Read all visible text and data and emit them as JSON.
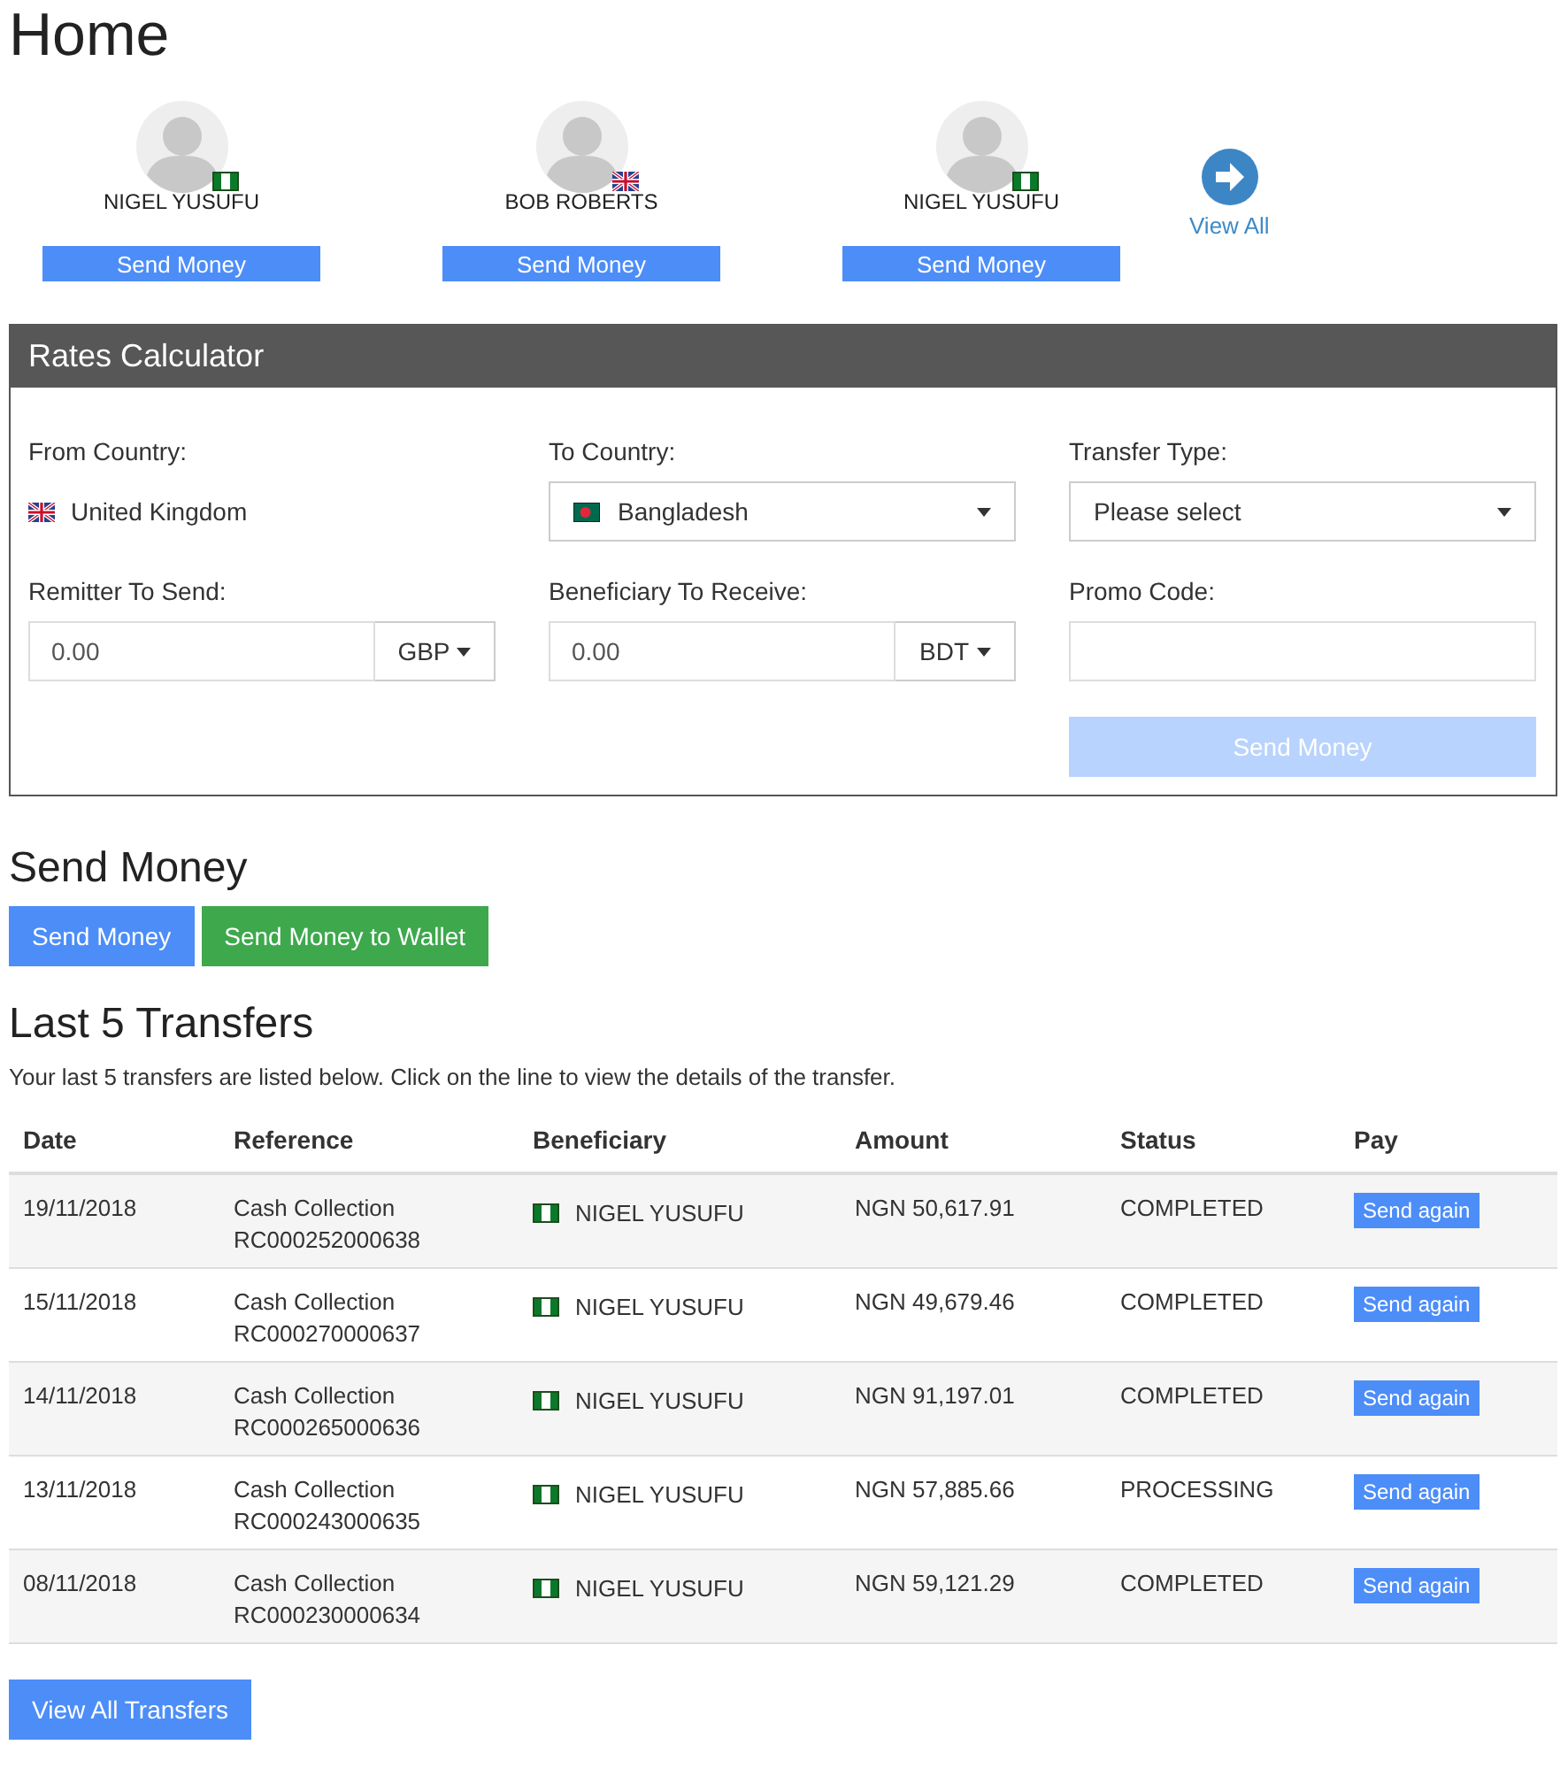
{
  "title": "Home",
  "beneficiaries": [
    {
      "name": "NIGEL YUSUFU",
      "flag": {
        "kind": "ng"
      },
      "button": "Send Money"
    },
    {
      "name": "BOB ROBERTS",
      "flag": {
        "kind": "gb"
      },
      "button": "Send Money"
    },
    {
      "name": "NIGEL YUSUFU",
      "flag": {
        "kind": "ng"
      },
      "button": "Send Money"
    }
  ],
  "view_all": "View All",
  "calculator": {
    "title": "Rates Calculator",
    "from_label": "From Country:",
    "from_flag": {
      "kind": "gb"
    },
    "from_value": "United Kingdom",
    "to_label": "To Country:",
    "to_flag": {
      "kind": "bd"
    },
    "to_value": "Bangladesh",
    "type_label": "Transfer Type:",
    "type_value": "Please select",
    "send_label": "Remitter To Send:",
    "send_value": "0.00",
    "send_currency": "GBP",
    "receive_label": "Beneficiary To Receive:",
    "receive_value": "0.00",
    "receive_currency": "BDT",
    "promo_label": "Promo Code:",
    "button": {
      "label": "Send Money",
      "disabled": true
    }
  },
  "send_section": {
    "title": "Send Money",
    "buttons": [
      {
        "label": "Send Money",
        "kind": "primary"
      },
      {
        "label": "Send Money to Wallet",
        "kind": "success"
      }
    ]
  },
  "transfers": {
    "title": "Last 5 Transfers",
    "intro": "Your last 5 transfers are listed below. Click on the line to view the details of the transfer.",
    "columns": [
      "Date",
      "Reference",
      "Beneficiary",
      "Amount",
      "Status",
      "Pay"
    ],
    "rows": [
      {
        "date": "19/11/2018",
        "type": "Cash Collection",
        "reference": "RC000252000638",
        "flag": {
          "kind": "ng"
        },
        "beneficiary": "NIGEL YUSUFU",
        "amount": "NGN 50,617.91",
        "status": "COMPLETED",
        "action": "Send again"
      },
      {
        "date": "15/11/2018",
        "type": "Cash Collection",
        "reference": "RC000270000637",
        "flag": {
          "kind": "ng"
        },
        "beneficiary": "NIGEL YUSUFU",
        "amount": "NGN 49,679.46",
        "status": "COMPLETED",
        "action": "Send again"
      },
      {
        "date": "14/11/2018",
        "type": "Cash Collection",
        "reference": "RC000265000636",
        "flag": {
          "kind": "ng"
        },
        "beneficiary": "NIGEL YUSUFU",
        "amount": "NGN 91,197.01",
        "status": "COMPLETED",
        "action": "Send again"
      },
      {
        "date": "13/11/2018",
        "type": "Cash Collection",
        "reference": "RC000243000635",
        "flag": {
          "kind": "ng"
        },
        "beneficiary": "NIGEL YUSUFU",
        "amount": "NGN 57,885.66",
        "status": "PROCESSING",
        "action": "Send again"
      },
      {
        "date": "08/11/2018",
        "type": "Cash Collection",
        "reference": "RC000230000634",
        "flag": {
          "kind": "ng"
        },
        "beneficiary": "NIGEL YUSUFU",
        "amount": "NGN 59,121.29",
        "status": "COMPLETED",
        "action": "Send again"
      }
    ],
    "view_all": "View All Transfers"
  }
}
